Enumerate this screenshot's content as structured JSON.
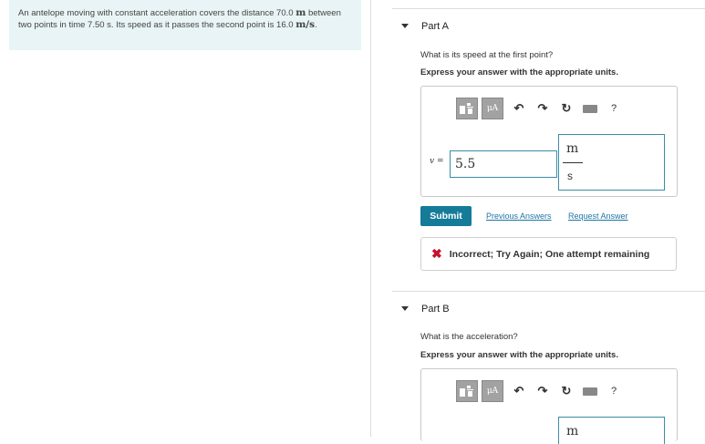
{
  "problem": {
    "text_before": "An antelope moving with constant acceleration covers the distance 70.0",
    "distance_unit": "m",
    "text_middle": "between two points in time 7.50 s. Its speed as it passes the second point is 16.0",
    "speed_unit": "m/s",
    "text_end": "."
  },
  "toolbar": {
    "templates_label": "templates",
    "units_label": "μA",
    "help_label": "?"
  },
  "part_a": {
    "title": "Part A",
    "question": "What is its speed at the first point?",
    "instruction": "Express your answer with the appropriate units.",
    "variable": "v",
    "equals": "=",
    "answer_value": "5.5",
    "unit_numerator": "m",
    "unit_denominator": "s",
    "submit_label": "Submit",
    "previous_answers_label": "Previous Answers",
    "request_answer_label": "Request Answer",
    "feedback_text": "Incorrect; Try Again; One attempt remaining"
  },
  "part_b": {
    "title": "Part B",
    "question": "What is the acceleration?",
    "instruction": "Express your answer with the appropriate units.",
    "unit_numerator": "m"
  },
  "colors": {
    "problem_bg": "#e8f4f5",
    "accent": "#157b99",
    "link": "#1e75a5",
    "error": "#c8102e"
  }
}
